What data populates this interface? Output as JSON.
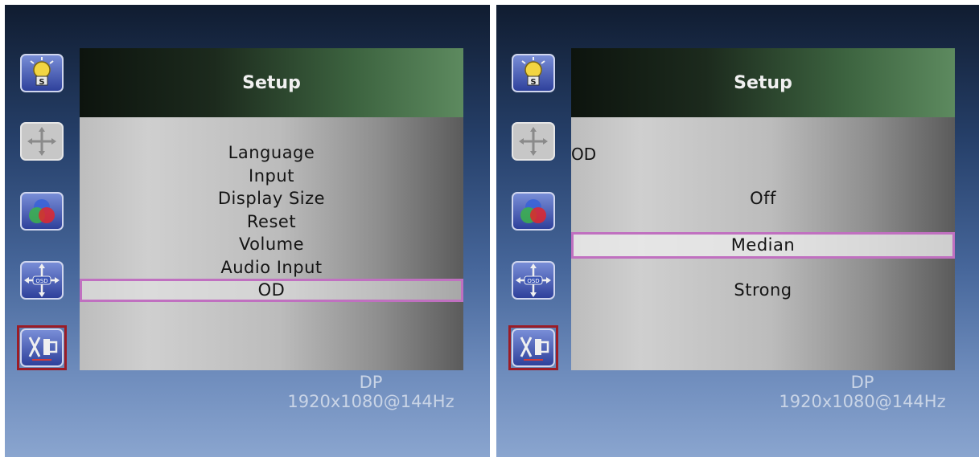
{
  "colors": {
    "selection_border": "#c070c0",
    "selected_icon_border": "#9b1c26",
    "header_green": "#5d8a5f",
    "status_text": "#c9d4e6"
  },
  "sidebar_icons": [
    "brightness-s-icon",
    "position-arrows-icon",
    "color-rgb-icon",
    "osd-icon",
    "setup-tools-icon"
  ],
  "left": {
    "title": "Setup",
    "items": [
      "Language",
      "Input",
      "Display Size",
      "Reset",
      "Volume",
      "Audio Input",
      "OD"
    ],
    "selected_index": 6,
    "status": {
      "input": "DP",
      "resolution": "1920x1080@144Hz"
    }
  },
  "right": {
    "title": "Setup",
    "sub_label": "OD",
    "options": [
      "Off",
      "Median",
      "Strong"
    ],
    "selected_index": 1,
    "status": {
      "input": "DP",
      "resolution": "1920x1080@144Hz"
    }
  }
}
